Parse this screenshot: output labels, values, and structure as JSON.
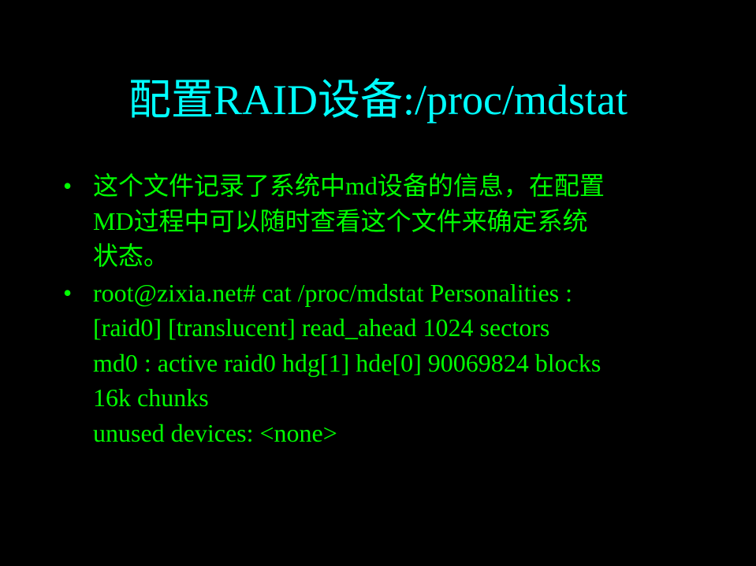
{
  "slide": {
    "title": "配置RAID设备:/proc/mdstat",
    "bullet_symbol": "•",
    "bullets": [
      {
        "lines": [
          "这个文件记录了系统中md设备的信息，在配置",
          "MD过程中可以随时查看这个文件来确定系统",
          "状态。"
        ]
      },
      {
        "lines": [
          "root@zixia.net# cat /proc/mdstat Personalities :",
          "[raid0] [translucent] read_ahead 1024 sectors",
          "md0 : active raid0 hdg[1] hde[0] 90069824 blocks",
          "16k chunks",
          "unused devices: <none>"
        ]
      }
    ]
  },
  "colors": {
    "background": "#000000",
    "title": "#00ffff",
    "body_text": "#00ff00"
  }
}
